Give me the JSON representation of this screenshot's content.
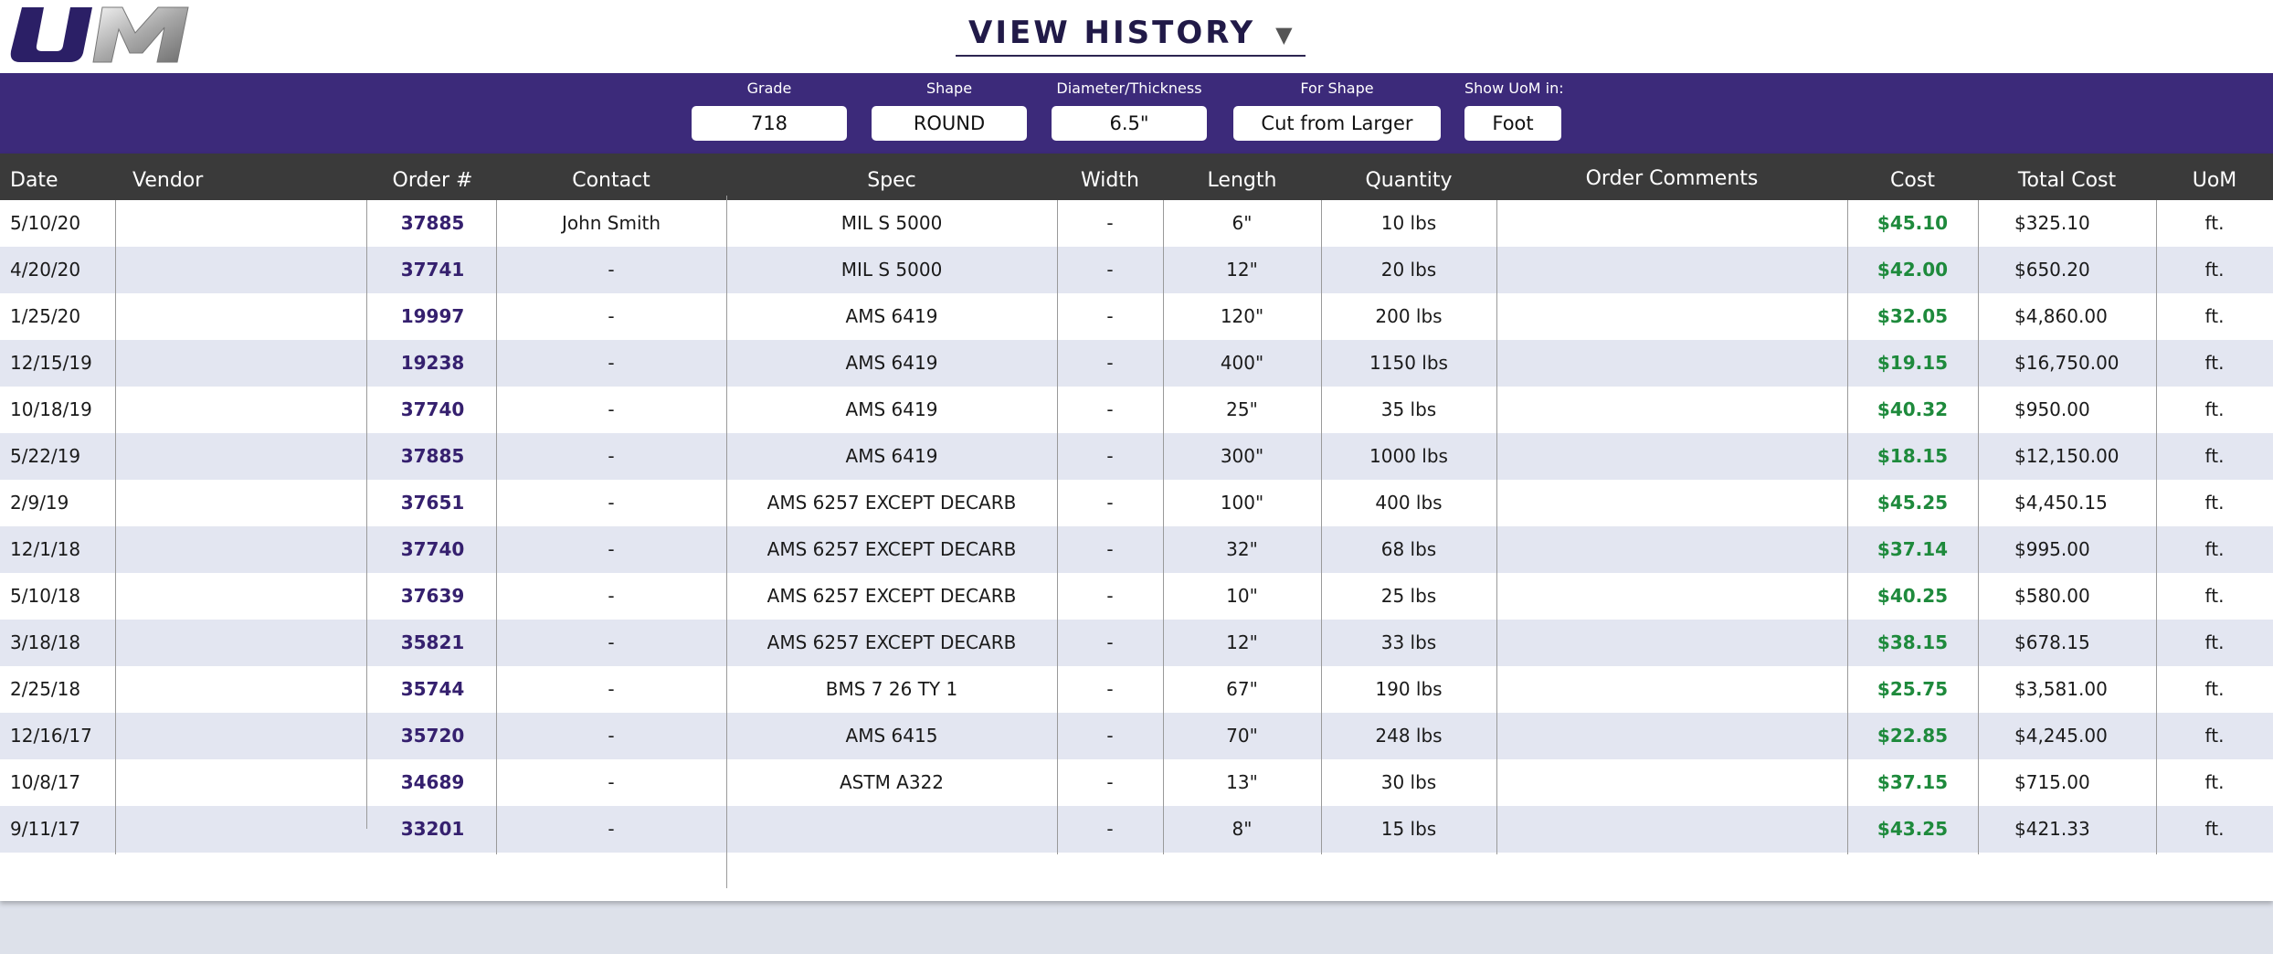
{
  "header": {
    "logo_text": "UM",
    "title": "VIEW HISTORY",
    "dropdown_icon": "caret-down-icon"
  },
  "filters": [
    {
      "label": "Grade",
      "value": "718"
    },
    {
      "label": "Shape",
      "value": "ROUND"
    },
    {
      "label": "Diameter/Thickness",
      "value": "6.5\""
    },
    {
      "label": "For Shape",
      "value": "Cut from Larger"
    },
    {
      "label": "Show UoM in:",
      "value": "Foot"
    }
  ],
  "table": {
    "columns": [
      "Date",
      "Vendor",
      "Order #",
      "Contact",
      "Spec",
      "Width",
      "Length",
      "Quantity",
      "Order Comments",
      "Cost",
      "Total Cost",
      "UoM"
    ],
    "rows": [
      [
        "5/10/20",
        "",
        "37885",
        "John Smith",
        "MIL S 5000",
        "-",
        "6\"",
        "10 lbs",
        "",
        "$45.10",
        "$325.10",
        "ft."
      ],
      [
        "4/20/20",
        "",
        "37741",
        "-",
        "MIL S 5000",
        "-",
        "12\"",
        "20 lbs",
        "",
        "$42.00",
        "$650.20",
        "ft."
      ],
      [
        "1/25/20",
        "",
        "19997",
        "-",
        "AMS 6419",
        "-",
        "120\"",
        "200 lbs",
        "",
        "$32.05",
        "$4,860.00",
        "ft."
      ],
      [
        "12/15/19",
        "",
        "19238",
        "-",
        "AMS 6419",
        "-",
        "400\"",
        "1150 lbs",
        "",
        "$19.15",
        "$16,750.00",
        "ft."
      ],
      [
        "10/18/19",
        "",
        "37740",
        "-",
        "AMS 6419",
        "-",
        "25\"",
        "35 lbs",
        "",
        "$40.32",
        "$950.00",
        "ft."
      ],
      [
        "5/22/19",
        "",
        "37885",
        "-",
        "AMS 6419",
        "-",
        "300\"",
        "1000 lbs",
        "",
        "$18.15",
        "$12,150.00",
        "ft."
      ],
      [
        "2/9/19",
        "",
        "37651",
        "-",
        "AMS 6257 EXCEPT DECARB",
        "-",
        "100\"",
        "400 lbs",
        "",
        "$45.25",
        "$4,450.15",
        "ft."
      ],
      [
        "12/1/18",
        "",
        "37740",
        "-",
        "AMS 6257 EXCEPT DECARB",
        "-",
        "32\"",
        "68 lbs",
        "",
        "$37.14",
        "$995.00",
        "ft."
      ],
      [
        "5/10/18",
        "",
        "37639",
        "-",
        "AMS 6257 EXCEPT DECARB",
        "-",
        "10\"",
        "25 lbs",
        "",
        "$40.25",
        "$580.00",
        "ft."
      ],
      [
        "3/18/18",
        "",
        "35821",
        "-",
        "AMS 6257 EXCEPT DECARB",
        "-",
        "12\"",
        "33 lbs",
        "",
        "$38.15",
        "$678.15",
        "ft."
      ],
      [
        "2/25/18",
        "",
        "35744",
        "-",
        "BMS 7 26 TY 1",
        "-",
        "67\"",
        "190 lbs",
        "",
        "$25.75",
        "$3,581.00",
        "ft."
      ],
      [
        "12/16/17",
        "",
        "35720",
        "-",
        "AMS 6415",
        "-",
        "70\"",
        "248 lbs",
        "",
        "$22.85",
        "$4,245.00",
        "ft."
      ],
      [
        "10/8/17",
        "",
        "34689",
        "-",
        "ASTM A322",
        "-",
        "13\"",
        "30 lbs",
        "",
        "$37.15",
        "$715.00",
        "ft."
      ],
      [
        "9/11/17",
        "",
        "33201",
        "-",
        "",
        "-",
        "8\"",
        "15 lbs",
        "",
        "$43.25",
        "$421.33",
        "ft."
      ]
    ]
  },
  "colors": {
    "brand_purple": "#3c2a7a",
    "header_dark": "#3a3a3a",
    "row_alt": "#e3e6f1",
    "order_link": "#35206e",
    "cost_green": "#1e8a3c"
  }
}
